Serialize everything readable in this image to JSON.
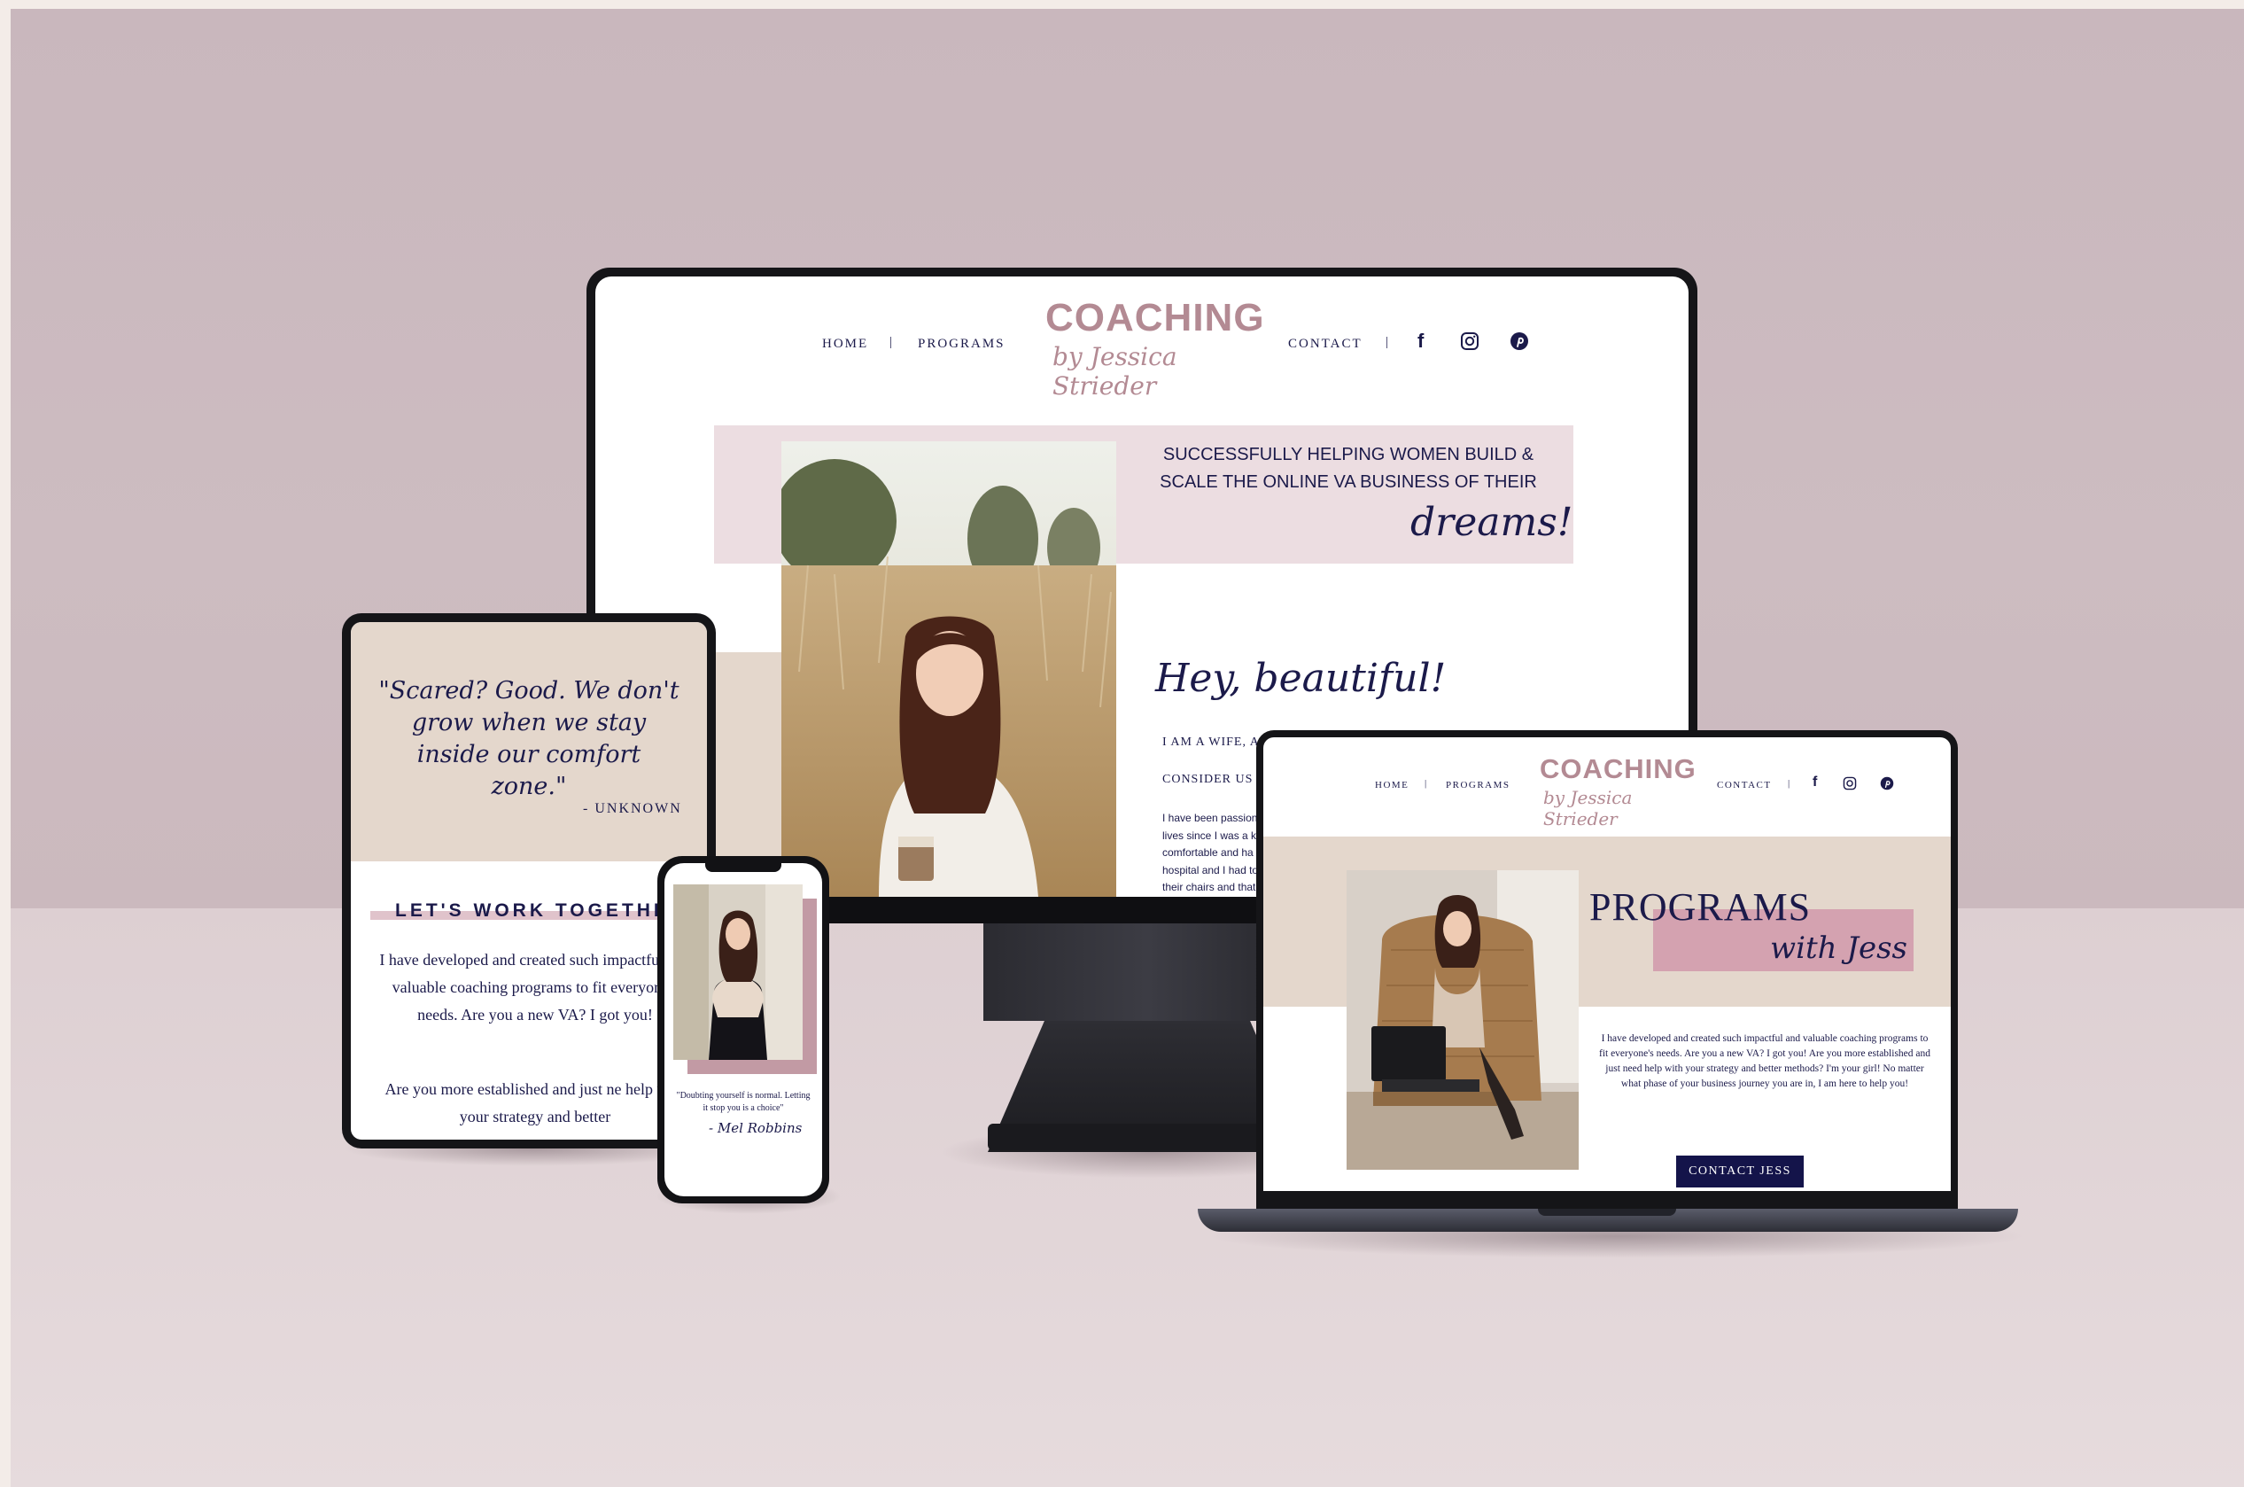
{
  "monitor": {
    "nav": {
      "home": "HOME",
      "sep1": "|",
      "programs": "PROGRAMS",
      "contact": "CONTACT",
      "sep2": "|"
    },
    "logo": {
      "title": "COACHING",
      "script": "by Jessica Strieder"
    },
    "social": [
      "facebook-icon",
      "instagram-icon",
      "pinterest-icon"
    ],
    "hero": {
      "line1": "SUCCESSFULLY HELPING WOMEN BUILD &",
      "line2": "SCALE THE ONLINE VA BUSINESS OF THEIR",
      "script": "dreams!"
    },
    "greeting": "Hey, beautiful!",
    "intro1": "I AM A WIFE, A M",
    "intro2": "CONSIDER US F",
    "body": [
      "I have been passion",
      "lives since I was a k",
      "comfortable and ha",
      "hospital and I had to",
      "their chairs and that"
    ]
  },
  "tablet": {
    "quote": "\"Scared? Good. We don't grow when we stay inside our comfort zone.\"",
    "attribution": "- UNKNOWN",
    "heading": "LET'S WORK TOGETHER",
    "p1": "I have developed and created such impactful and valuable coaching programs to fit everyone's needs. Are you a new VA? I got you!",
    "p2": "Are you more established and just ne help with your strategy and better"
  },
  "phone": {
    "quote": "\"Doubting yourself is normal. Letting it stop you is a choice\"",
    "signature": "- Mel Robbins"
  },
  "laptop": {
    "nav": {
      "home": "HOME",
      "sep1": "|",
      "programs": "PROGRAMS",
      "contact": "CONTACT",
      "sep2": "|"
    },
    "logo": {
      "title": "COACHING",
      "script": "by Jessica Strieder"
    },
    "programs_title": "PROGRAMS",
    "programs_script": "with Jess",
    "body": "I have developed and created such impactful and valuable coaching programs to fit everyone's needs. Are you a new VA? I got you! Are you more established and just need help with your strategy and better methods? I'm your girl! No matter what phase of your business journey you are in, I am here to help you!",
    "cta": "CONTACT JESS"
  },
  "colors": {
    "navy": "#1b1a4a",
    "dusty_pink": "#b38a93",
    "blush": "#ecdde1",
    "beige": "#e4d7cc"
  }
}
